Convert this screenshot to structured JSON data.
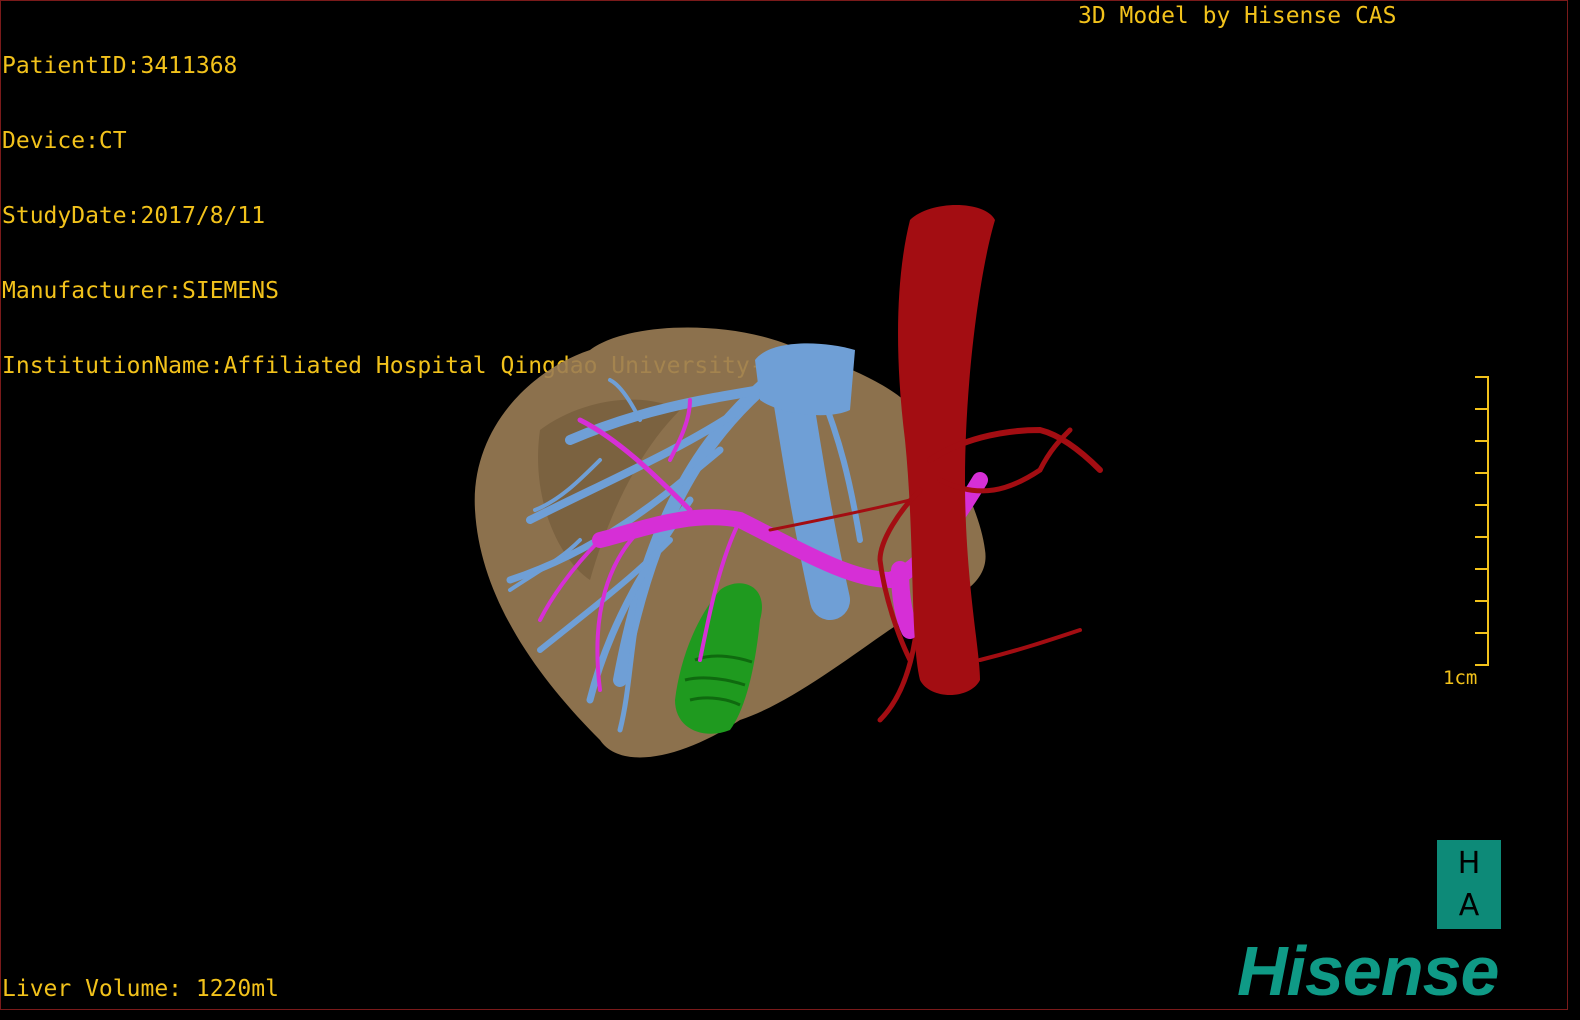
{
  "meta": {
    "patient_id": "PatientID:3411368",
    "device": "Device:CT",
    "study_date": "StudyDate:2017/8/11",
    "manufacturer": "Manufacturer:SIEMENS",
    "institution": "InstitutionName:Affiliated Hospital Qingdao University-C"
  },
  "brand_top": "3D Model by Hisense CAS",
  "scale_label": "1cm",
  "liver_volume": "Liver Volume: 1220ml",
  "logo": {
    "h": "H",
    "a": "A",
    "brand": "Hisense"
  },
  "colors": {
    "text": "#f2c21b",
    "liver": "#9b7d55",
    "hepatic_vein": "#6f9fd6",
    "portal_vein": "#d62fd6",
    "aorta": "#a30d12",
    "gallbladder": "#1f9a1f",
    "brand": "#0f9a86"
  },
  "icons": [
    "ha-logo-icon",
    "hisense-logo-icon",
    "scale-bar-icon"
  ]
}
